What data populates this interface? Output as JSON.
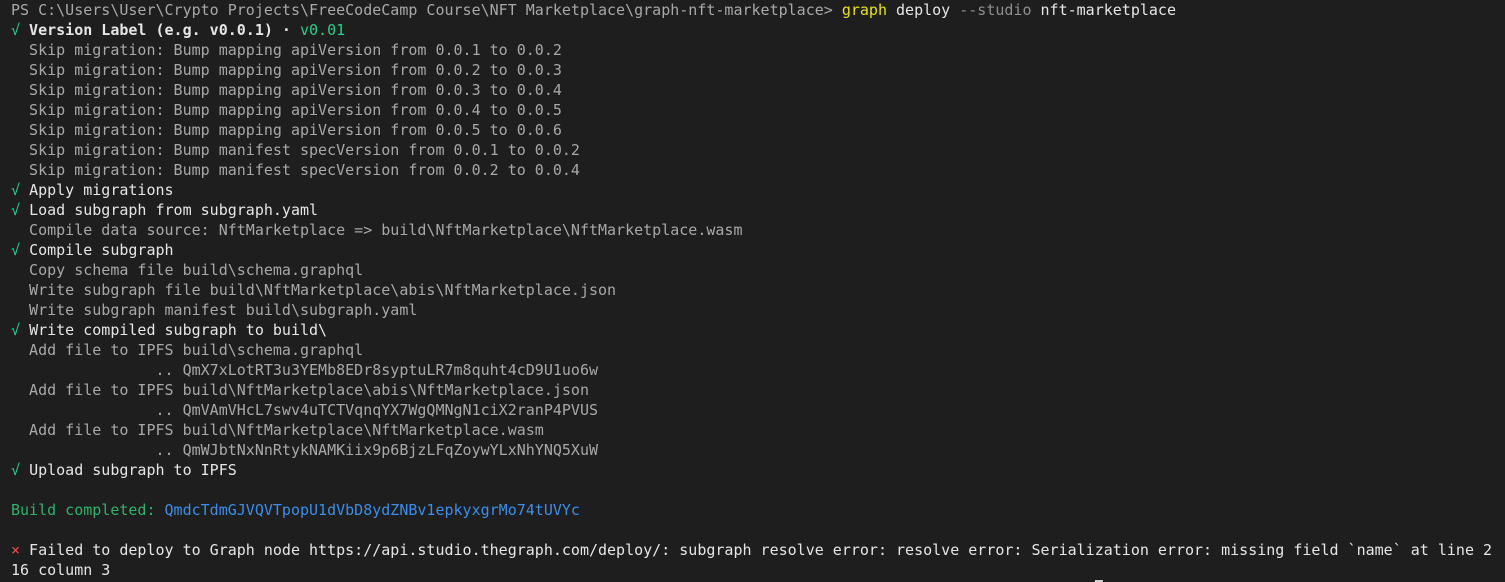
{
  "prompt": {
    "ps_path": "PS C:\\Users\\User\\Crypto Projects\\FreeCodeCamp Course\\NFT Marketplace\\graph-nft-marketplace> ",
    "cmd": "graph",
    "args": " deploy ",
    "flag": "--studio",
    "target": " nft-marketplace"
  },
  "version": {
    "check": "√",
    "label": " Version Label (e.g. v0.0.1) · ",
    "value": "v0.01"
  },
  "migrations": [
    "  Skip migration: Bump mapping apiVersion from 0.0.1 to 0.0.2",
    "  Skip migration: Bump mapping apiVersion from 0.0.2 to 0.0.3",
    "  Skip migration: Bump mapping apiVersion from 0.0.3 to 0.0.4",
    "  Skip migration: Bump mapping apiVersion from 0.0.4 to 0.0.5",
    "  Skip migration: Bump mapping apiVersion from 0.0.5 to 0.0.6",
    "  Skip migration: Bump manifest specVersion from 0.0.1 to 0.0.2",
    "  Skip migration: Bump manifest specVersion from 0.0.2 to 0.0.4"
  ],
  "steps": {
    "apply": "Apply migrations",
    "load": "Load subgraph from subgraph.yaml",
    "compile_ds": "  Compile data source: NftMarketplace => build\\NftMarketplace\\NftMarketplace.wasm",
    "compile": "Compile subgraph",
    "copy_schema": "  Copy schema file build\\schema.graphql",
    "write_subgraph": "  Write subgraph file build\\NftMarketplace\\abis\\NftMarketplace.json",
    "write_manifest": "  Write subgraph manifest build\\subgraph.yaml",
    "write_compiled": "Write compiled subgraph to build\\",
    "add1": "  Add file to IPFS build\\schema.graphql",
    "hash1": "                .. QmX7xLotRT3u3YEMb8EDr8syptuLR7m8quht4cD9U1uo6w",
    "add2": "  Add file to IPFS build\\NftMarketplace\\abis\\NftMarketplace.json",
    "hash2": "                .. QmVAmVHcL7swv4uTCTVqnqYX7WgQMNgN1ciX2ranP4PVUS",
    "add3": "  Add file to IPFS build\\NftMarketplace\\NftMarketplace.wasm",
    "hash3": "                .. QmWJbtNxNnRtykNAMKiix9p6BjzLFqZoywYLxNhYNQ5XuW",
    "upload": "Upload subgraph to IPFS"
  },
  "check_mark": "√",
  "build": {
    "label": "Build completed: ",
    "hash": "QmdcTdmGJVQVTpopU1dVbD8ydZNBv1epkyxgrMo74tUVYc"
  },
  "error": {
    "mark": "×",
    "line1": " Failed to deploy to Graph node https://api.studio.thegraph.com/deploy/: subgraph resolve error: resolve error: Serialization error: missing field `name` at line 2",
    "line2": "16 column 3"
  },
  "colors": {
    "background": "#1e1e1e",
    "success": "#23d18b",
    "command": "#e5e510",
    "hash": "#3b8eea",
    "error": "#f14c4c"
  }
}
